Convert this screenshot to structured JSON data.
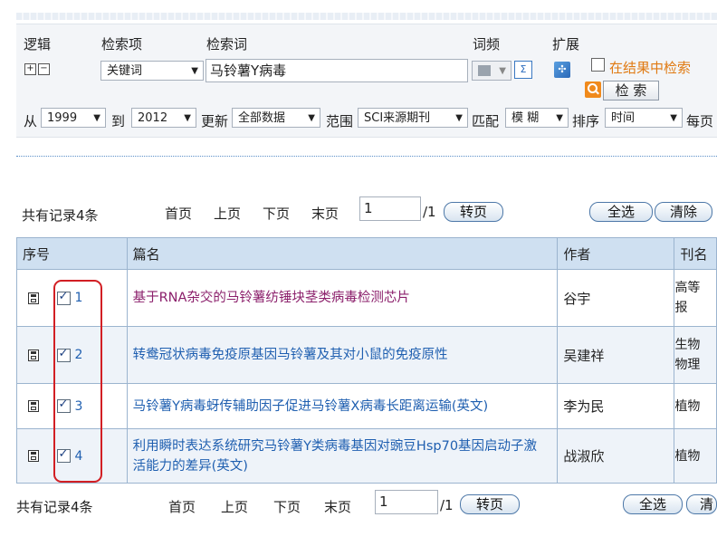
{
  "search": {
    "col_logic": "逻辑",
    "col_field": "检索项",
    "col_term": "检索词",
    "col_freq": "词频",
    "col_expand": "扩展",
    "field_value": "关键词",
    "term_value": "马铃薯Y病毒",
    "in_results_label": "在结果中检索",
    "search_button": "检 索",
    "from_label": "从",
    "from_value": "1999",
    "to_label": "到",
    "to_value": "2012",
    "update_label": "更新",
    "update_value": "全部数据",
    "range_label": "范围",
    "range_value": "SCI来源期刊",
    "match_label": "匹配",
    "match_value": "模 糊",
    "sort_label": "排序",
    "sort_value": "时间",
    "per_page_label": "每页",
    "colors": {
      "accent_orange": "#e07a12",
      "link_blue": "#1f5fb0",
      "header_blue": "#cfe0f1",
      "red_outline": "#d21f24"
    }
  },
  "pager_top": {
    "total": "共有记录4条",
    "first": "首页",
    "prev": "上页",
    "next": "下页",
    "last": "末页",
    "page_value": "1",
    "page_total": "/1",
    "go_button": "转页",
    "select_all": "全选",
    "clear": "清除"
  },
  "pager_bottom": {
    "total": "共有记录4条",
    "first": "首页",
    "prev": "上页",
    "next": "下页",
    "last": "末页",
    "page_value": "1",
    "page_total": "/1",
    "go_button": "转页",
    "select_all": "全选",
    "clear": "清"
  },
  "table": {
    "headers": [
      "序号",
      "篇名",
      "作者",
      "刊名"
    ],
    "rows": [
      {
        "num": "1",
        "title": "基于RNA杂交的马铃薯纺锤块茎类病毒检测芯片",
        "author": "谷宇",
        "journal_line1": "高等",
        "journal_line2": "报"
      },
      {
        "num": "2",
        "title": "转鸯冠状病毒免疫原基因马铃薯及其对小鼠的免疫原性",
        "author": "吴建祥",
        "journal_line1": "生物",
        "journal_line2": "物理"
      },
      {
        "num": "3",
        "title": "马铃薯Y病毒蚜传辅助因子促进马铃薯X病毒长距离运输(英文)",
        "author": "李为民",
        "journal_line1": "植物",
        "journal_line2": ""
      },
      {
        "num": "4",
        "title": "利用瞬时表达系统研究马铃薯Y类病毒基因对豌豆Hsp70基因启动子激活能力的差异(英文)",
        "author": "战淑欣",
        "journal_line1": "植物",
        "journal_line2": ""
      }
    ]
  }
}
